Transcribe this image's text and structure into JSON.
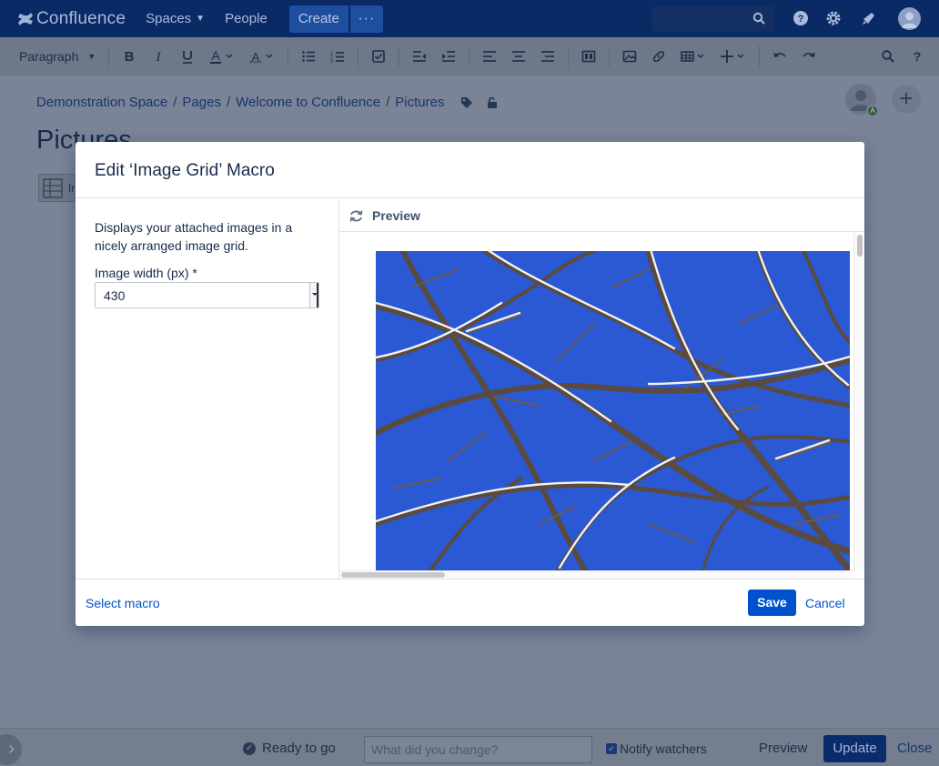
{
  "topnav": {
    "logo_text": "Confluence",
    "spaces_label": "Spaces",
    "people_label": "People",
    "create_label": "Create",
    "more_label": "···"
  },
  "toolbar": {
    "paragraph_label": "Paragraph"
  },
  "page": {
    "breadcrumbs": [
      "Demonstration Space",
      "Pages",
      "Welcome to Confluence",
      "Pictures"
    ],
    "breadcrumb_separator": "/",
    "title": "Pictures",
    "macro_placeholder_text": "Ir",
    "avatar_badge": "A"
  },
  "dialog": {
    "title": "Edit ‘Image Grid’ Macro",
    "description": "Displays your attached images in a nicely arranged image grid.",
    "field_label": "Image width (px) *",
    "field_value": "430",
    "preview_label": "Preview",
    "select_macro_label": "Select macro",
    "save_label": "Save",
    "cancel_label": "Cancel"
  },
  "bottombar": {
    "status": "Ready to go",
    "change_placeholder": "What did you change?",
    "notify_label": "Notify watchers",
    "notify_checked": true,
    "preview_label": "Preview",
    "update_label": "Update",
    "close_label": "Close"
  },
  "colors": {
    "nav_bg": "#0a2a66",
    "primary": "#0052cc",
    "overlay_bg": "#7a8496"
  }
}
